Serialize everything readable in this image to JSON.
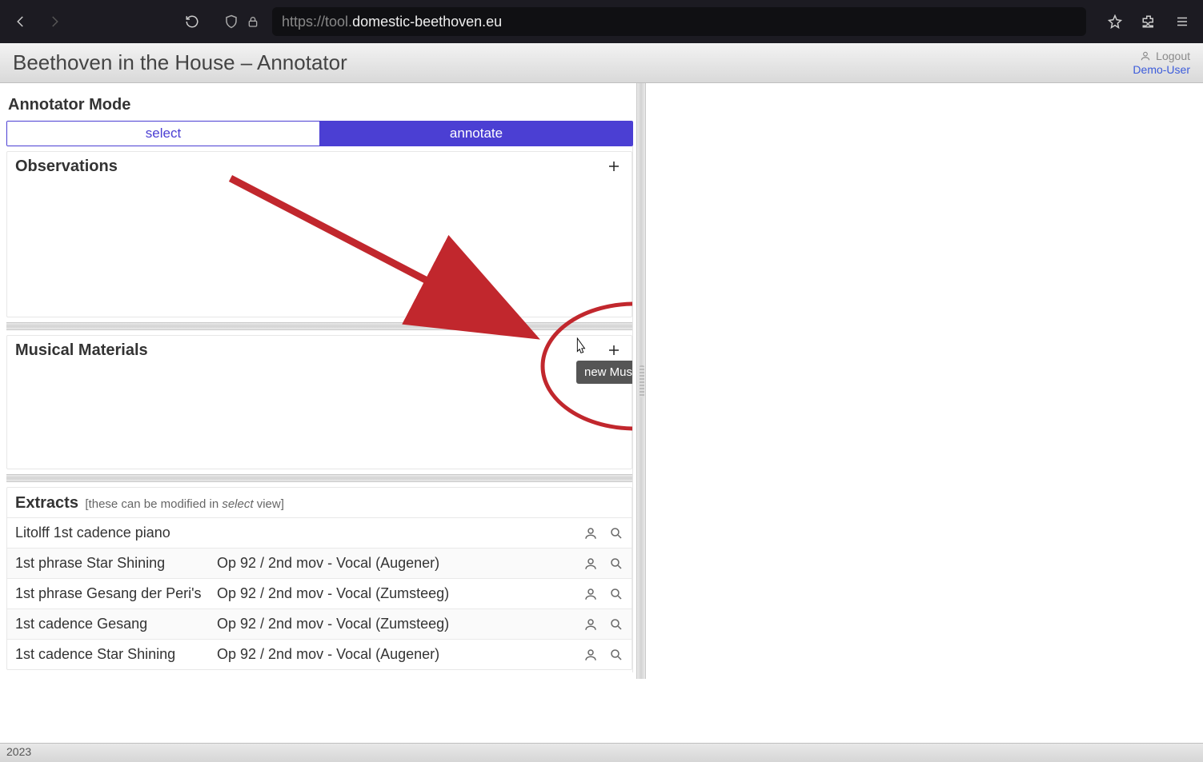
{
  "browser": {
    "url_prefix": "https://tool.",
    "url_domain": "domestic-beethoven.eu",
    "url_suffix": ""
  },
  "app": {
    "title": "Beethoven in the House – Annotator",
    "logout": "Logout",
    "username": "Demo-User"
  },
  "mode": {
    "label": "Annotator Mode",
    "select": "select",
    "annotate": "annotate"
  },
  "sections": {
    "observations": "Observations",
    "musical_materials": "Musical Materials",
    "extracts_title": "Extracts",
    "extracts_hint_pre": "[these can be modified in ",
    "extracts_hint_em": "select",
    "extracts_hint_post": " view]"
  },
  "tooltip": {
    "new_mm": "new Musical Material"
  },
  "extracts": [
    {
      "name": "Litolff 1st cadence piano",
      "source": ""
    },
    {
      "name": "1st phrase Star Shining",
      "source": "Op 92 / 2nd mov - Vocal (Augener)"
    },
    {
      "name": "1st phrase Gesang der Peri's",
      "source": "Op 92 / 2nd mov - Vocal (Zumsteeg)"
    },
    {
      "name": "1st cadence Gesang",
      "source": "Op 92 / 2nd mov - Vocal (Zumsteeg)"
    },
    {
      "name": "1st cadence Star Shining",
      "source": "Op 92 / 2nd mov - Vocal (Augener)"
    }
  ],
  "footer": {
    "year": "2023"
  }
}
